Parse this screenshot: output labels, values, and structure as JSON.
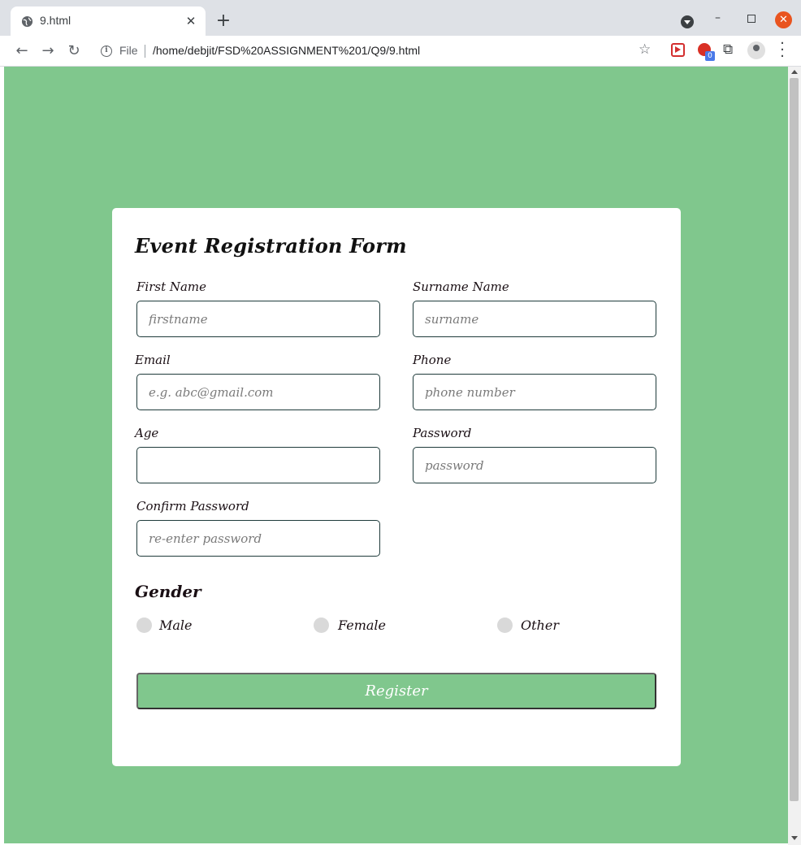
{
  "browser": {
    "tab_title": "9.html",
    "tab_close": "✕",
    "new_tab": "+",
    "file_label": "File",
    "url": "/home/debjit/FSD%20ASSIGNMENT%201/Q9/9.html",
    "extension_badge": "0"
  },
  "form": {
    "title": "Event Registration Form",
    "fields": {
      "first_name": {
        "label": "First Name",
        "placeholder": "firstname"
      },
      "surname": {
        "label": "Surname Name",
        "placeholder": "surname"
      },
      "email": {
        "label": "Email",
        "placeholder": "e.g. abc@gmail.com"
      },
      "phone": {
        "label": "Phone",
        "placeholder": "phone number"
      },
      "age": {
        "label": "Age",
        "placeholder": ""
      },
      "password": {
        "label": "Password",
        "placeholder": "password"
      },
      "confirm_password": {
        "label": "Confirm Password",
        "placeholder": "re-enter password"
      }
    },
    "gender": {
      "title": "Gender",
      "options": [
        "Male",
        "Female",
        "Other"
      ]
    },
    "register_label": "Register"
  },
  "colors": {
    "page_background": "#80c78d",
    "card_background": "#ffffff",
    "register_button": "#80c78d"
  }
}
